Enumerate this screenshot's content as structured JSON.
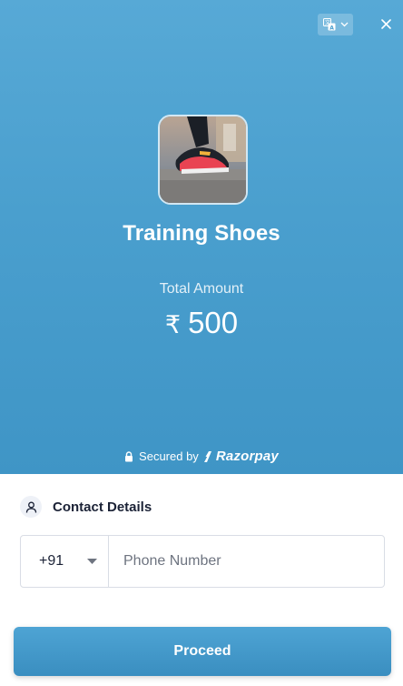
{
  "colors": {
    "header_bg": "#4a9fce",
    "primary_button": "#4499ca",
    "text_dark": "#1b2236",
    "placeholder": "#6e7480"
  },
  "header": {
    "language_icon": "translate-icon",
    "close_icon": "close-icon"
  },
  "product": {
    "title": "Training Shoes",
    "amount_label": "Total Amount",
    "currency_symbol": "₹",
    "amount": "500"
  },
  "footer_brand": {
    "secured_by": "Secured by",
    "brand": "Razorpay"
  },
  "contact": {
    "title": "Contact Details",
    "country_code": "+91",
    "phone_placeholder": "Phone Number"
  },
  "actions": {
    "proceed_label": "Proceed"
  }
}
